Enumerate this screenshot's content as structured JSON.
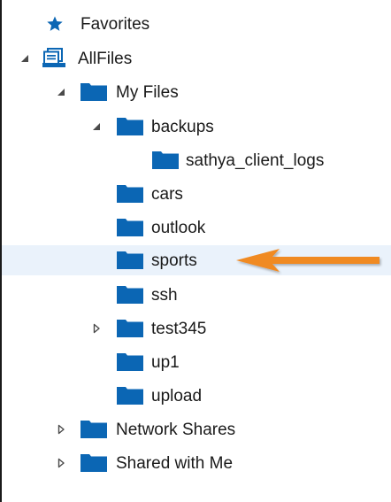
{
  "tree": {
    "favorites": {
      "label": "Favorites",
      "icon": "star-icon"
    },
    "all_files": {
      "label": "AllFiles",
      "icon": "file-stack-icon",
      "state": "expanded"
    },
    "my_files": {
      "label": "My Files",
      "icon": "folder-icon",
      "state": "expanded"
    },
    "backups": {
      "label": "backups",
      "icon": "folder-icon",
      "state": "expanded"
    },
    "sathya_client_logs": {
      "label": "sathya_client_logs",
      "icon": "folder-icon"
    },
    "cars": {
      "label": "cars",
      "icon": "folder-icon"
    },
    "outlook": {
      "label": "outlook",
      "icon": "folder-icon"
    },
    "sports": {
      "label": "sports",
      "icon": "folder-icon",
      "highlighted": true
    },
    "ssh": {
      "label": "ssh",
      "icon": "folder-icon"
    },
    "test345": {
      "label": "test345",
      "icon": "folder-icon",
      "state": "collapsed"
    },
    "up1": {
      "label": "up1",
      "icon": "folder-icon"
    },
    "upload": {
      "label": "upload",
      "icon": "folder-icon"
    },
    "network_shares": {
      "label": "Network Shares",
      "icon": "folder-icon",
      "state": "collapsed"
    },
    "shared_with_me": {
      "label": "Shared with Me",
      "icon": "folder-icon",
      "state": "collapsed"
    }
  },
  "annotation": {
    "icon": "arrow-left-icon",
    "color": "#f08a24"
  },
  "colors": {
    "folder": "#0b66b4",
    "star": "#0b66b4",
    "text": "#1a1a1a",
    "highlight": "#eaf2fb",
    "toggle": "#4a4a4a"
  }
}
